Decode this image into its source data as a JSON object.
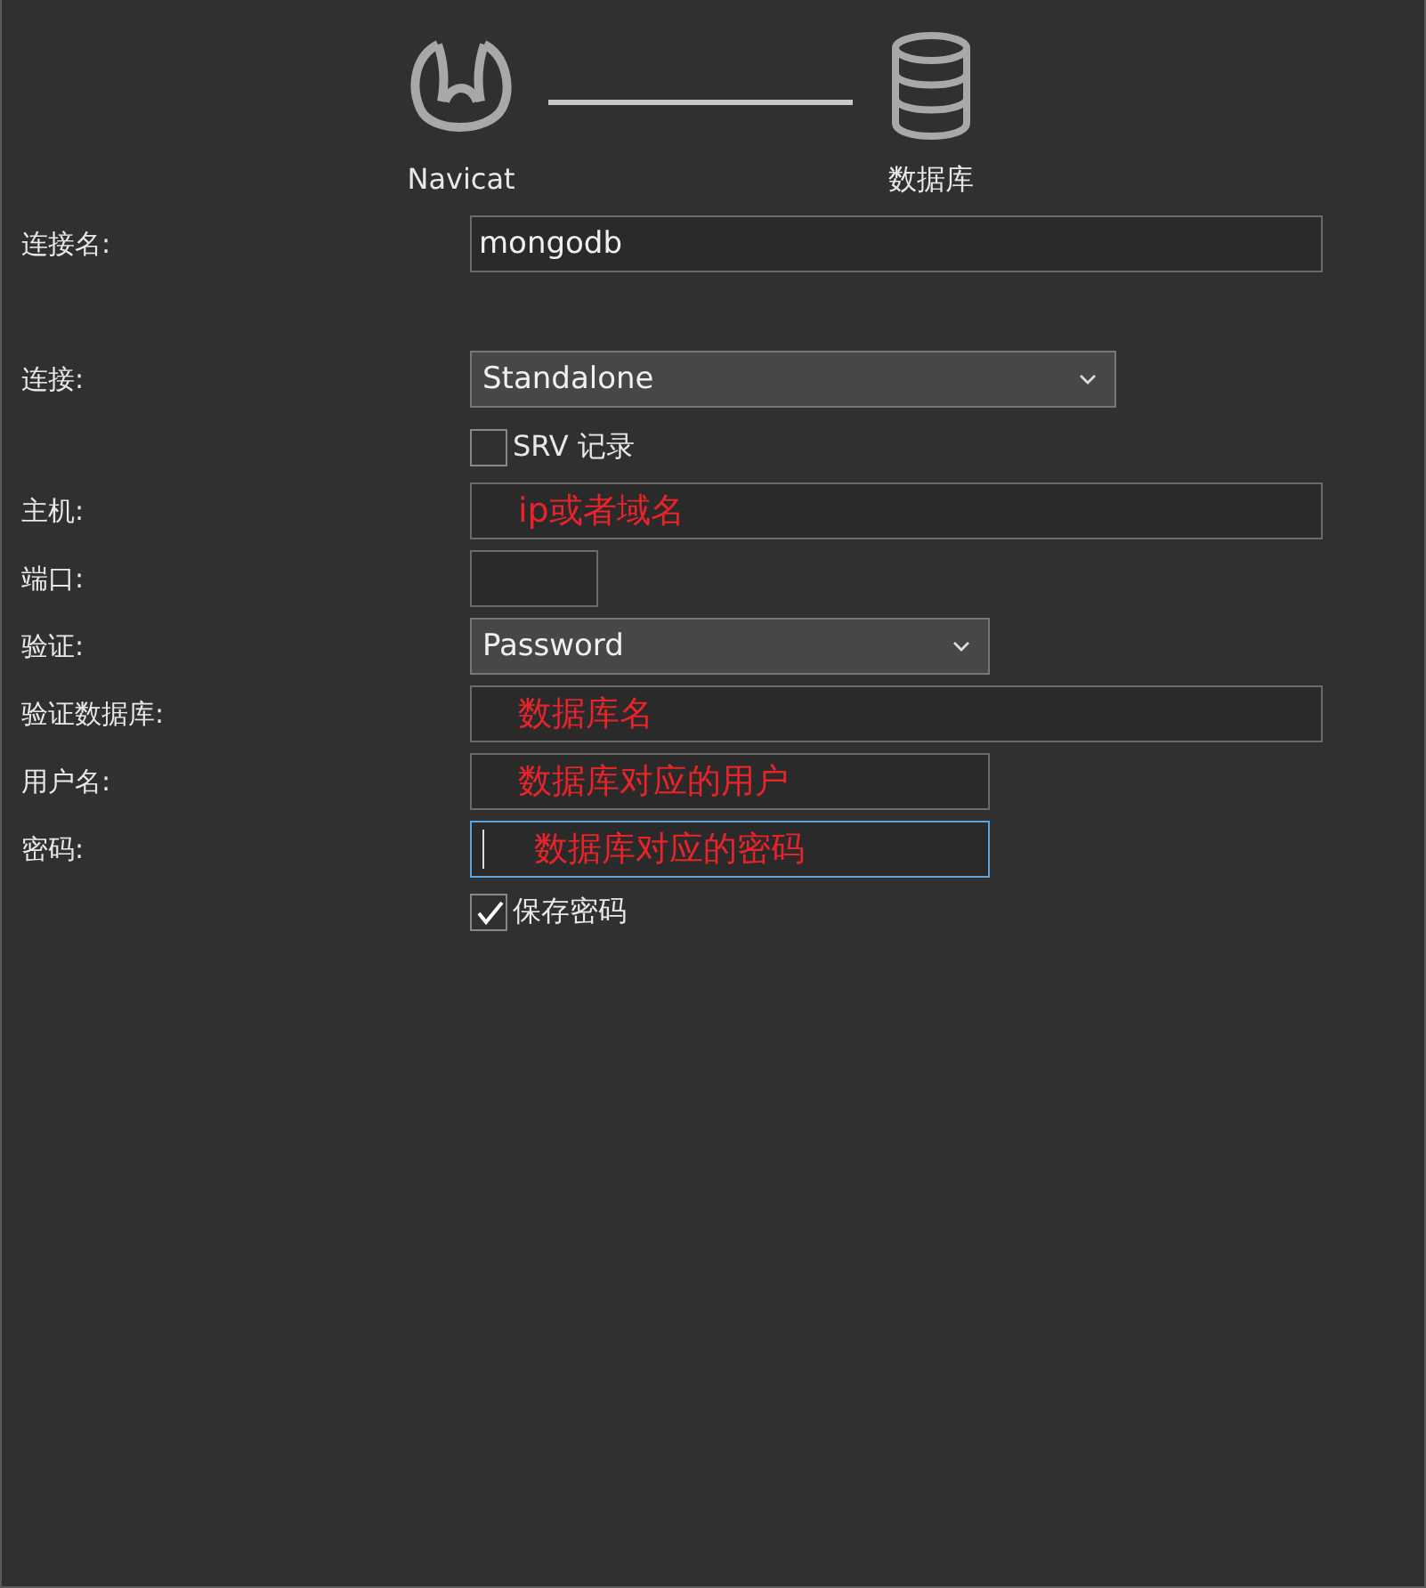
{
  "header": {
    "source_label": "Navicat",
    "target_label": "数据库"
  },
  "fields": [
    {
      "kind": "text",
      "label": "连接名:",
      "value": "mongodb"
    },
    {
      "kind": "select",
      "label": "连接:",
      "value": "Standalone"
    },
    {
      "kind": "checkbox",
      "label": "SRV 记录",
      "checked": false
    },
    {
      "kind": "text",
      "label": "主机:",
      "annotation": "ip或者域名"
    },
    {
      "kind": "text",
      "label": "端口:"
    },
    {
      "kind": "select",
      "label": "验证:",
      "value": "Password"
    },
    {
      "kind": "text",
      "label": "验证数据库:",
      "annotation": "数据库名"
    },
    {
      "kind": "text",
      "label": "用户名:",
      "annotation": "数据库对应的用户"
    },
    {
      "kind": "text",
      "label": "密码:",
      "annotation": "数据库对应的密码",
      "focused": true
    },
    {
      "kind": "checkbox",
      "label": "保存密码",
      "checked": true
    }
  ]
}
